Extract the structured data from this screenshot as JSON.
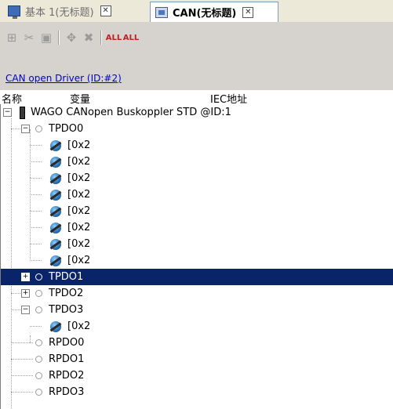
{
  "tabs": [
    {
      "label": "基本 1(无标题)",
      "icon": "monitor-icon",
      "active": false
    },
    {
      "label": "CAN(无标题)",
      "icon": "chip-icon",
      "active": true
    }
  ],
  "toolbar": {
    "buttons": [
      "add-icon",
      "cut-icon",
      "paste-icon",
      "move-icon",
      "delete-icon",
      "add-all-icon",
      "remove-all-icon"
    ],
    "all_labels": [
      "ALL",
      "ALL"
    ]
  },
  "driver_link": "CAN open Driver (ID:#2)",
  "columns": {
    "name": "名称",
    "variable": "变量",
    "iec": "IEC地址"
  },
  "tree": {
    "root": "WAGO CANopen Buskoppler STD @ID:1",
    "items": [
      {
        "label": "TPDO0",
        "expander": "−",
        "children": [
          "[0x2",
          "[0x2",
          "[0x2",
          "[0x2",
          "[0x2",
          "[0x2",
          "[0x2",
          "[0x2"
        ]
      },
      {
        "label": "TPDO1",
        "expander": "+",
        "selected": true
      },
      {
        "label": "TPDO2",
        "expander": "+"
      },
      {
        "label": "TPDO3",
        "expander": "−",
        "children": [
          "[0x2"
        ]
      },
      {
        "label": "RPDO0"
      },
      {
        "label": "RPDO1"
      },
      {
        "label": "RPDO2"
      },
      {
        "label": "RPDO3"
      }
    ]
  },
  "colors": {
    "selection": "#0a246a",
    "link": "#0000cc",
    "toolbar_bg": "#d6d3ce"
  }
}
